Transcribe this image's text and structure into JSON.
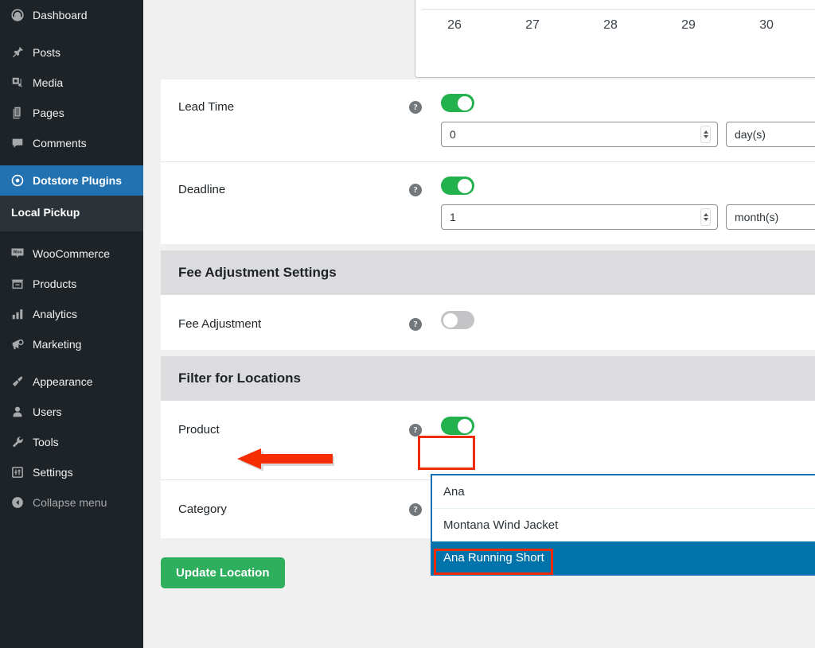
{
  "sidebar": {
    "items": [
      {
        "label": "Dashboard",
        "icon": "dashboard-icon",
        "state": "normal"
      },
      {
        "label": "Posts",
        "icon": "pin-icon",
        "state": "normal"
      },
      {
        "label": "Media",
        "icon": "media-icon",
        "state": "normal"
      },
      {
        "label": "Pages",
        "icon": "pages-icon",
        "state": "normal"
      },
      {
        "label": "Comments",
        "icon": "comments-icon",
        "state": "normal"
      },
      {
        "label": "Dotstore Plugins",
        "icon": "dotstore-icon",
        "state": "current"
      },
      {
        "label": "WooCommerce",
        "icon": "woo-icon",
        "state": "normal"
      },
      {
        "label": "Products",
        "icon": "products-icon",
        "state": "normal"
      },
      {
        "label": "Analytics",
        "icon": "analytics-icon",
        "state": "normal"
      },
      {
        "label": "Marketing",
        "icon": "marketing-icon",
        "state": "normal"
      },
      {
        "label": "Appearance",
        "icon": "appearance-icon",
        "state": "normal"
      },
      {
        "label": "Users",
        "icon": "users-icon",
        "state": "normal"
      },
      {
        "label": "Tools",
        "icon": "tools-icon",
        "state": "normal"
      },
      {
        "label": "Settings",
        "icon": "settings-icon",
        "state": "normal"
      },
      {
        "label": "Collapse menu",
        "icon": "collapse-icon",
        "state": "dim"
      }
    ],
    "submenu": {
      "label": "Local Pickup"
    }
  },
  "calendar": {
    "days": [
      "26",
      "27",
      "28",
      "29",
      "30"
    ]
  },
  "lead_time": {
    "label": "Lead Time",
    "toggle_state": "on",
    "value": "0",
    "unit": "day(s)",
    "help": "?"
  },
  "deadline": {
    "label": "Deadline",
    "toggle_state": "on",
    "value": "1",
    "unit": "month(s)",
    "help": "?"
  },
  "fee_section": {
    "header": "Fee Adjustment Settings",
    "row_label": "Fee Adjustment",
    "toggle_state": "off",
    "help": "?"
  },
  "filter_section": {
    "header": "Filter for Locations",
    "product": {
      "label": "Product",
      "toggle_state": "on",
      "help": "?"
    },
    "category": {
      "label": "Category",
      "help": "?"
    }
  },
  "dropdown": {
    "search_value": "Ana",
    "options": [
      {
        "label": "Montana Wind Jacket",
        "selected": false
      },
      {
        "label": "Ana Running Short",
        "selected": true
      }
    ]
  },
  "footer": {
    "update_label": "Update Location"
  },
  "colors": {
    "sidebar_bg": "#1d2327",
    "current_blue": "#2271b1",
    "toggle_green": "#22b14c",
    "button_green": "#2eaf5d",
    "annotation_red": "#ef2b06",
    "dropdown_selected": "#0073aa",
    "section_header_gray": "#dcdcde",
    "page_bg": "#f0f0f1"
  }
}
